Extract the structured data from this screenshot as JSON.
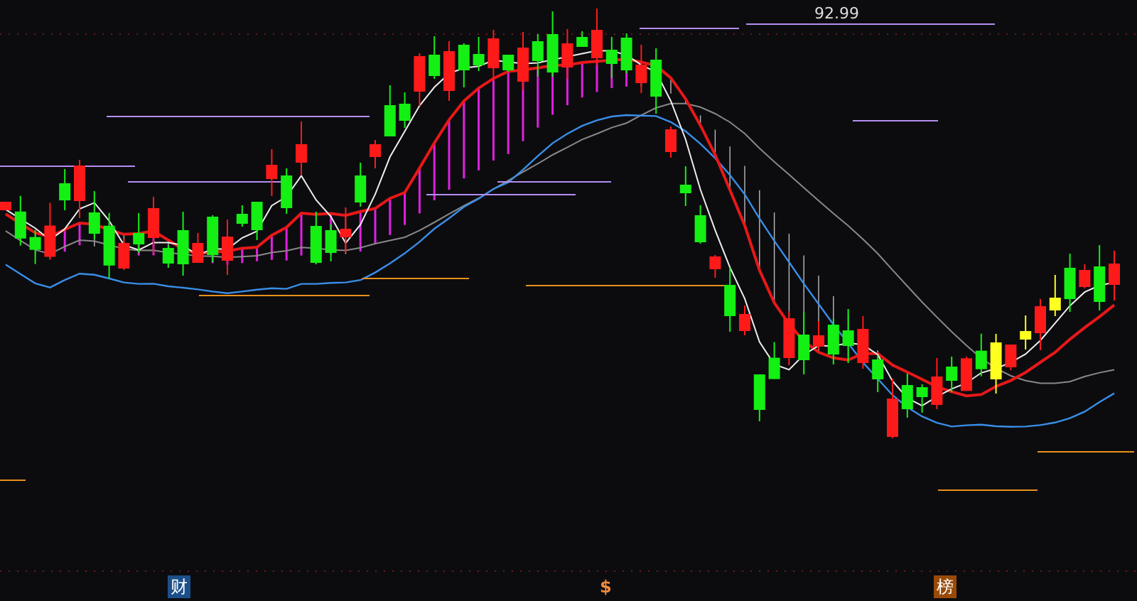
{
  "chart": {
    "high_label": "92.99"
  },
  "markers": [
    {
      "label": "财",
      "kind": "badge",
      "color": "#1c4f8a"
    },
    {
      "label": "$",
      "kind": "glyph",
      "color": "#f08a3c"
    },
    {
      "label": "榜",
      "kind": "badge",
      "color": "#9a4a08"
    }
  ]
}
